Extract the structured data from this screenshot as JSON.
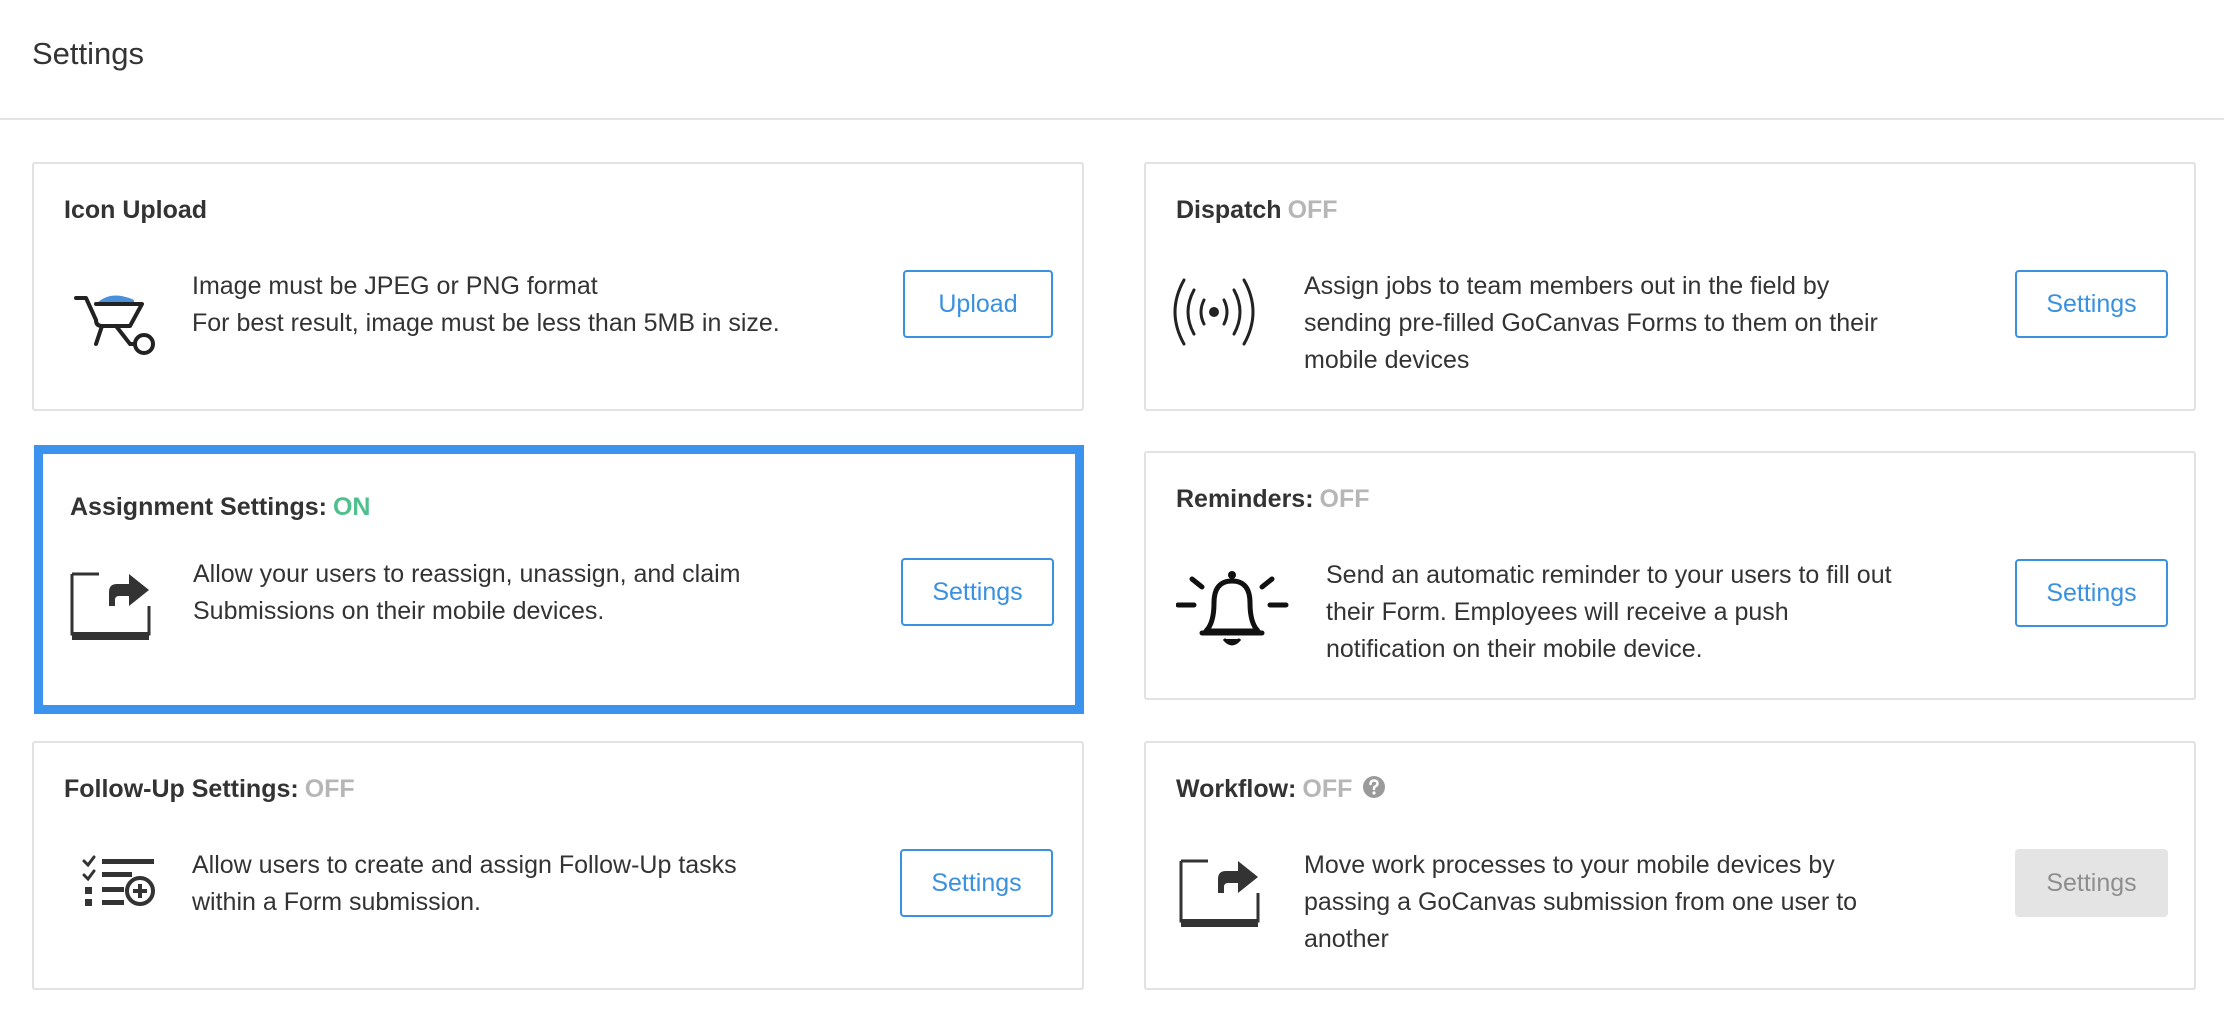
{
  "page": {
    "title": "Settings"
  },
  "cards": {
    "icon_upload": {
      "title": "Icon Upload",
      "icon": "wheelbarrow-icon",
      "description": [
        "Image must be JPEG or PNG format",
        "For best result, image must be less than 5MB in size."
      ],
      "button": "Upload"
    },
    "dispatch": {
      "title": "Dispatch",
      "status": "OFF",
      "icon": "broadcast-icon",
      "description": [
        "Assign jobs to team members out in the field by",
        "sending pre-filled GoCanvas Forms to them on their",
        "mobile devices"
      ],
      "button": "Settings"
    },
    "assignment": {
      "title": "Assignment Settings:",
      "status": "ON",
      "icon": "share-box-icon",
      "description": [
        "Allow your users to reassign, unassign, and claim",
        "Submissions on their mobile devices."
      ],
      "button": "Settings"
    },
    "reminders": {
      "title": "Reminders:",
      "status": "OFF",
      "icon": "bell-icon",
      "description": [
        "Send an automatic reminder to your users to fill out",
        "their Form. Employees will receive a push",
        "notification on their mobile device."
      ],
      "button": "Settings"
    },
    "followup": {
      "title": "Follow-Up Settings:",
      "status": "OFF",
      "icon": "checklist-add-icon",
      "description": [
        "Allow users to create and assign Follow-Up tasks",
        "within a Form submission."
      ],
      "button": "Settings"
    },
    "workflow": {
      "title": "Workflow:",
      "status": "OFF",
      "icon": "share-box-icon",
      "help_icon": "question-circle-icon",
      "description": [
        "Move work processes to your mobile devices by",
        "passing a GoCanvas submission from one user to",
        "another"
      ],
      "button": "Settings",
      "button_disabled": true
    }
  },
  "colors": {
    "accent": "#3a91e0",
    "highlight_border": "#3b93ee",
    "status_on": "#4fc08d",
    "status_off": "#b6b6b6",
    "disabled_button_bg": "#e4e4e4"
  }
}
